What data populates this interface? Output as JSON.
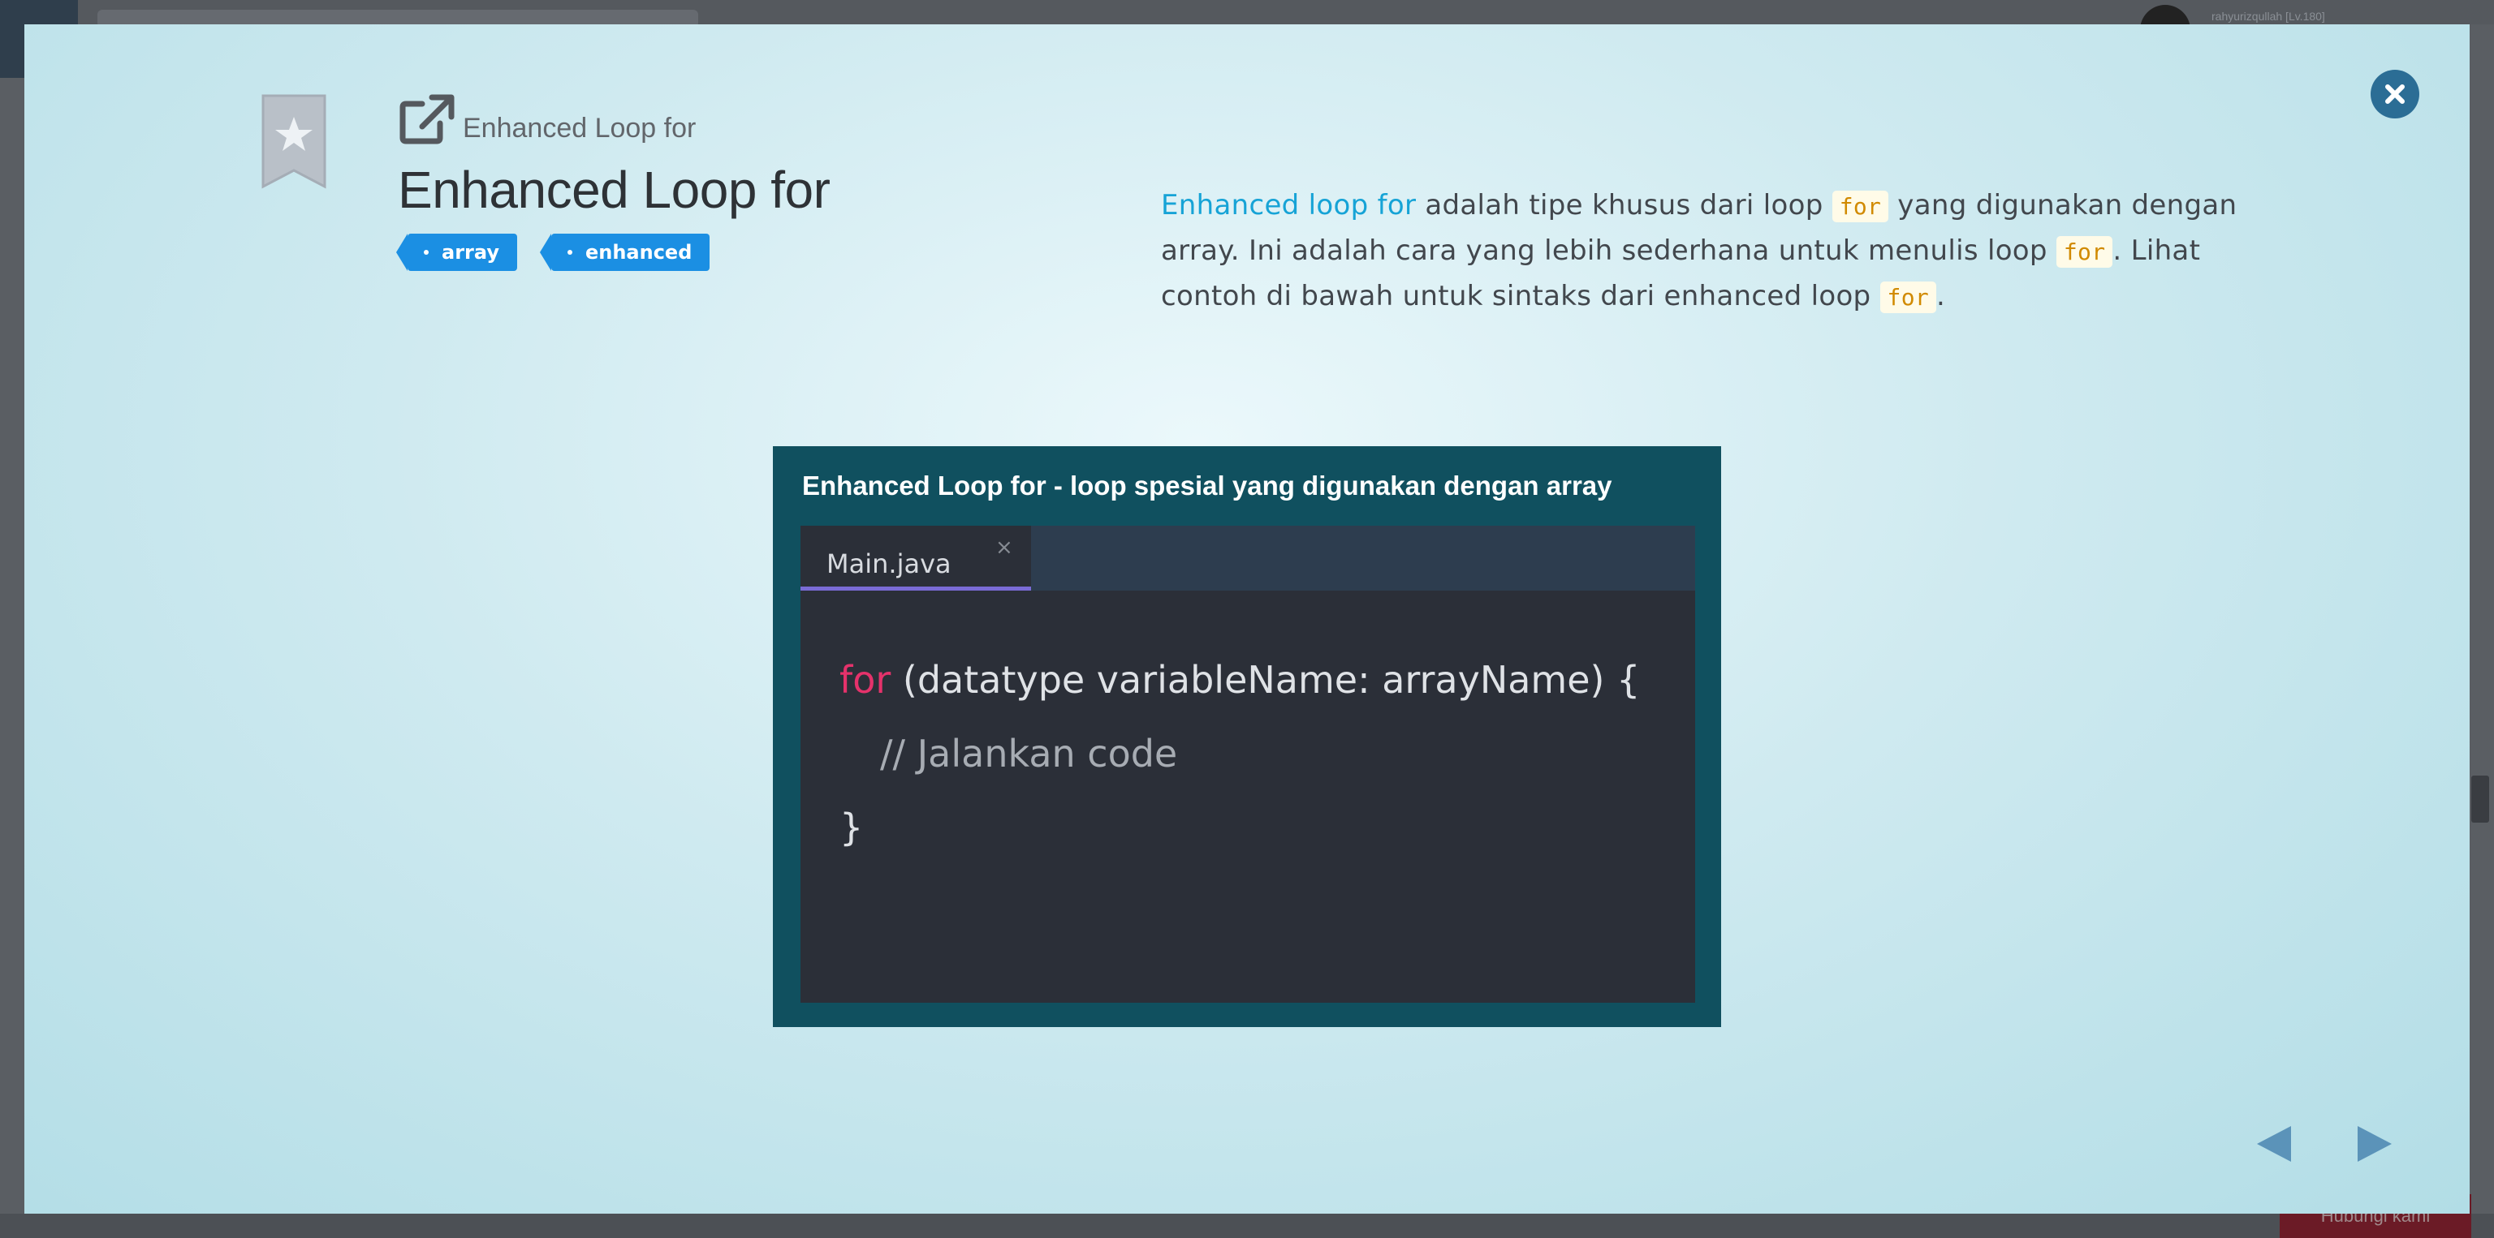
{
  "background": {
    "username": "rahyurizqullah [Lv.180]",
    "help_button": "Hubungi kami"
  },
  "modal": {
    "subtitle": "Enhanced Loop for",
    "title": "Enhanced Loop for",
    "tags": [
      "array",
      "enhanced"
    ],
    "description": {
      "highlight": "Enhanced loop for",
      "part1": " adalah tipe khusus dari loop ",
      "code1": "for",
      "part2": " yang digunakan dengan array. Ini adalah cara yang lebih sederhana untuk menulis loop ",
      "code2": "for",
      "part3": ". Lihat contoh di bawah untuk sintaks dari enhanced loop ",
      "code3": "for",
      "part4": "."
    },
    "card": {
      "title": "Enhanced Loop for - loop spesial yang digunakan dengan array",
      "file_tab": "Main.java",
      "tab_close": "×",
      "code": {
        "keyword": "for",
        "line1_rest": " (datatype variableName: arrayName) {",
        "line2": "// Jalankan code",
        "line3": "}"
      }
    }
  },
  "colors": {
    "accent": "#1b8fe3",
    "highlight": "#16a3d6",
    "code_keyword": "#e5326b",
    "inline_code": "#d18a00",
    "card_bg": "#10505f",
    "close_button": "#2b6d95"
  },
  "icons": {
    "bookmark": "bookmark-star-icon",
    "external": "external-link-icon",
    "close": "close-icon",
    "prev": "arrow-left-icon",
    "next": "arrow-right-icon"
  }
}
